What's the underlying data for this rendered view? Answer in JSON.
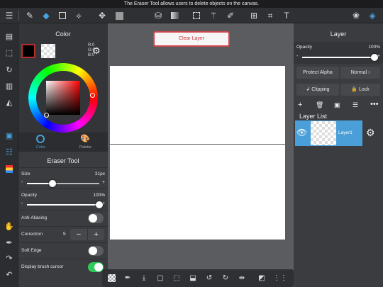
{
  "status": {
    "message": "The Eraser Tool allows users to delete objects on the canvas."
  },
  "colors": {
    "accent": "#4a9fd8",
    "clear_border": "#d0464c",
    "toggle_on": "#2ecc5b"
  },
  "toolbar": {
    "items": [
      "menu-icon",
      "brush-icon",
      "eraser-icon",
      "rectangle-icon",
      "wand-icon",
      "move-icon",
      "fill-color-icon",
      "bucket-icon",
      "gradient-icon",
      "select-rect-icon",
      "magic-wand-icon",
      "pen-select-icon",
      "transform-icon",
      "crop-icon",
      "text-icon",
      "materials-icon",
      "layers-icon"
    ]
  },
  "color_panel": {
    "title": "Color",
    "r": "R:0",
    "g": "G:0",
    "b": "B:0",
    "tab_color": "Color",
    "tab_palette": "Palette"
  },
  "eraser": {
    "title": "Eraser Tool",
    "size_label": "Size",
    "size_value": "31px",
    "size_fraction": 0.35,
    "opacity_label": "Opacity",
    "opacity_value": "100%",
    "opacity_fraction": 1.0,
    "minus": "-",
    "plus": "+",
    "anti_aliasing": "Anti-Aliasing",
    "anti_aliasing_on": false,
    "correction": "Correction",
    "correction_value": "5",
    "soft_edge": "Soft Edge",
    "soft_edge_on": false,
    "display_cursor": "Display brush cursor",
    "display_cursor_on": true
  },
  "canvas": {
    "clear_label": "Clear Layer"
  },
  "layer_panel": {
    "title": "Layer",
    "opacity_label": "Opacity",
    "opacity_value": "100%",
    "opacity_fraction": 1.0,
    "protect_alpha": "Protect Alpha",
    "blend_mode": "Normal",
    "clipping": "Clipping",
    "lock": "Lock",
    "list_title": "Layer List",
    "layers": [
      {
        "name": "Layer1"
      }
    ]
  }
}
